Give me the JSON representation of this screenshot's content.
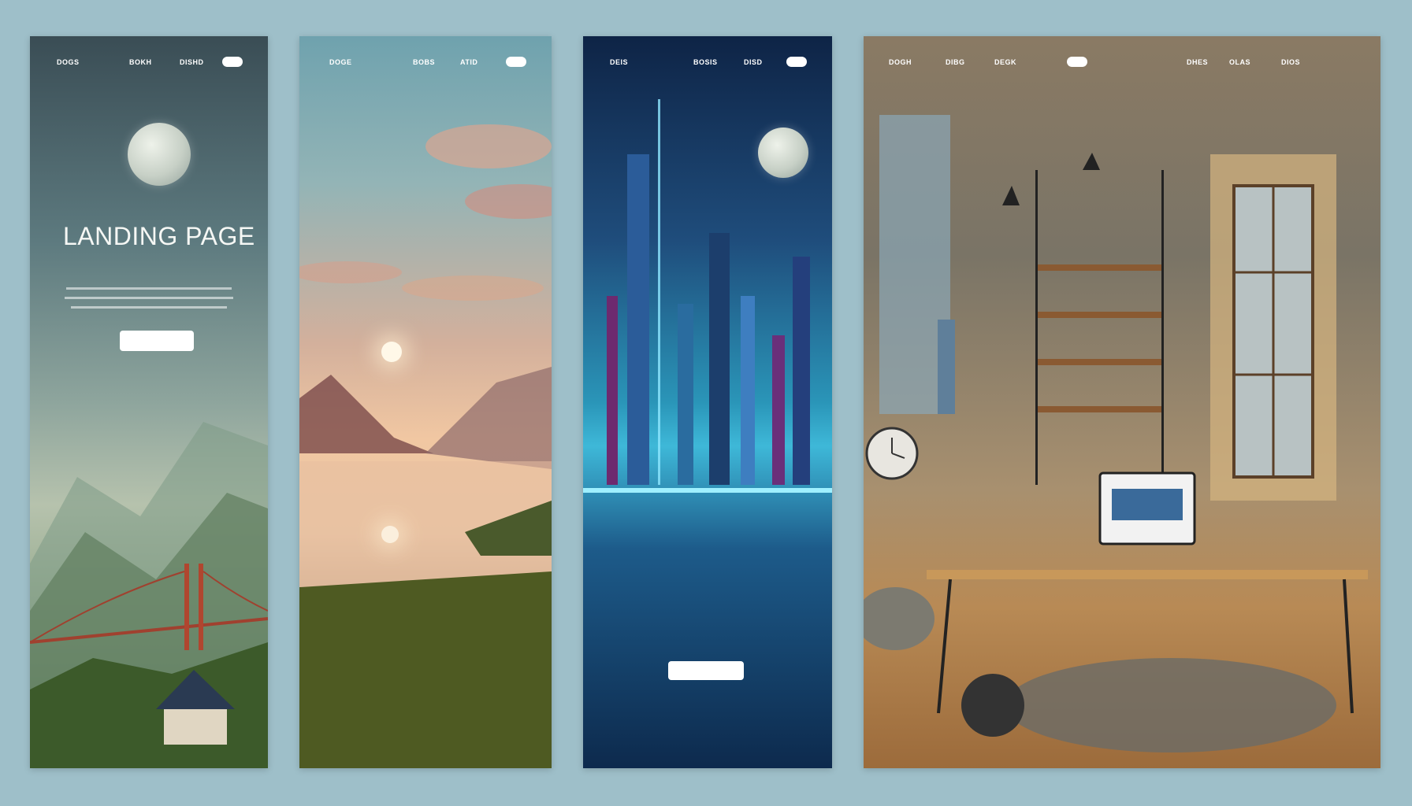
{
  "panels": [
    {
      "theme": "misty-mountains",
      "nav": {
        "links": [
          "DOGS",
          "BOKH",
          "DISHD"
        ],
        "pill": ""
      },
      "title": "LANDING PAGE",
      "body_lines": [
        "",
        "",
        ""
      ],
      "cta_label": "",
      "icons": [
        "moon-icon"
      ]
    },
    {
      "theme": "sunset-lake",
      "nav": {
        "links": [
          "DOGE",
          "BOBS",
          "ATID"
        ],
        "pill": ""
      },
      "icons": [
        "sun-icon"
      ]
    },
    {
      "theme": "neon-city",
      "nav": {
        "links": [
          "DEIS",
          "BOSIS",
          "DISD"
        ],
        "pill": ""
      },
      "headline": "",
      "cta_label": "",
      "icons": [
        "moon-icon"
      ]
    },
    {
      "theme": "workspace-interior",
      "nav": {
        "links": [
          "DOGH",
          "DIBG",
          "DEGK",
          "DHES",
          "OLAS",
          "DIOS"
        ],
        "pill": ""
      },
      "icons": [
        "lamp-icon",
        "clock-icon",
        "monitor-icon"
      ]
    }
  ],
  "colors": {
    "page_bg": "#9ebfc9",
    "text": "#ffffff",
    "button_bg": "#ffffff"
  }
}
